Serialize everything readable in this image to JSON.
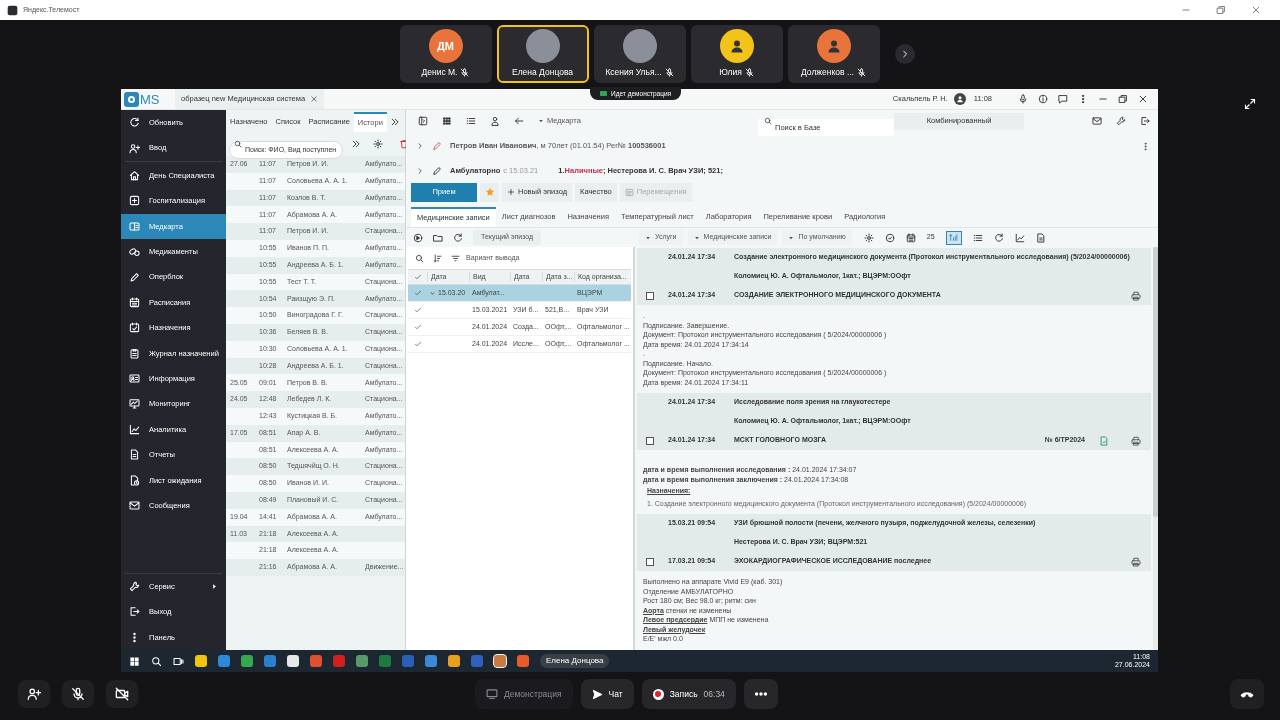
{
  "meeting": {
    "title": "Яндекс.Телемост"
  },
  "participants": [
    {
      "kind": "initials",
      "initials": "ДМ",
      "name": "Денис М.",
      "color": "#e8743b",
      "muted": true,
      "selected": false
    },
    {
      "kind": "photo",
      "name": "Елена Донцова",
      "muted": false,
      "selected": true
    },
    {
      "kind": "photo",
      "name": "Ксения Улья...",
      "muted": true,
      "selected": false
    },
    {
      "kind": "silhouette",
      "name": "Юлия",
      "color": "#f2c318",
      "muted": true,
      "selected": false
    },
    {
      "kind": "silhouette",
      "name": "Долженков ...",
      "color": "#e8743b",
      "muted": true,
      "selected": false
    }
  ],
  "demo_banner": "Идет демонстрация",
  "app": {
    "logo": "MS",
    "doc_tab": "образец new Медицинская система",
    "user": "Скальпель Р. Н.",
    "time": "11:08",
    "sidebar": {
      "items": [
        {
          "label": "Обновить",
          "selected": false
        },
        {
          "label": "Ввод",
          "selected": false
        },
        {
          "label": "День Специалиста",
          "selected": false
        },
        {
          "label": "Госпитализация",
          "selected": false
        },
        {
          "label": "Медкарта",
          "selected": true
        },
        {
          "label": "Медикаменты",
          "selected": false
        },
        {
          "label": "Оперблок",
          "selected": false
        },
        {
          "label": "Расписания",
          "selected": false
        },
        {
          "label": "Назначения",
          "selected": false
        },
        {
          "label": "Журнал назначений",
          "selected": false
        },
        {
          "label": "Информация",
          "selected": false
        },
        {
          "label": "Мониторинг",
          "selected": false
        },
        {
          "label": "Аналитика",
          "selected": false
        },
        {
          "label": "Отчеты",
          "selected": false
        },
        {
          "label": "Лист ожидания",
          "selected": false
        },
        {
          "label": "Сообщения",
          "selected": false
        }
      ],
      "footer_items": [
        {
          "label": "Сервис",
          "has_submenu": true
        },
        {
          "label": "Выход",
          "has_submenu": false
        },
        {
          "label": "Панель",
          "has_submenu": false
        }
      ]
    },
    "list": {
      "tabs": [
        {
          "label": "Назначено",
          "selected": false
        },
        {
          "label": "Список",
          "selected": false
        },
        {
          "label": "Расписание",
          "selected": false
        },
        {
          "label": "Истори",
          "selected": true
        }
      ],
      "search": {
        "placeholder": "Поиск: ФИО, Вид поступлен"
      },
      "rows": [
        {
          "date": "27.06",
          "time": "11:07",
          "name": "Петров И. И.",
          "type": "Амбулато..."
        },
        {
          "time": "11:07",
          "name": "Соловьева А. А. 1.",
          "type": "Амбулато..."
        },
        {
          "time": "11:07",
          "name": "Козлов В. Т.",
          "type": "Амбулато..."
        },
        {
          "time": "11:07",
          "name": "Абрамова А. А.",
          "type": "Амбулато..."
        },
        {
          "time": "11:07",
          "name": "Петров И. И.",
          "type": "Стациона..."
        },
        {
          "time": "10:55",
          "name": "Иванов П. П.",
          "type": "Амбулато..."
        },
        {
          "time": "10:55",
          "name": "Андреева А. Б. 1.",
          "type": "Амбулато..."
        },
        {
          "time": "10:55",
          "name": "Тест Т. Т.",
          "type": "Стациона..."
        },
        {
          "time": "10:54",
          "name": "Раизщую Э. П.",
          "type": "Амбулато..."
        },
        {
          "time": "10:50",
          "name": "Виноградова Г. Г.",
          "type": "Стациона..."
        },
        {
          "time": "10:36",
          "name": "Беляев В. В.",
          "type": "Стациона..."
        },
        {
          "time": "10:30",
          "name": "Соловьева А. А. 1.",
          "type": "Стациона..."
        },
        {
          "time": "10:28",
          "name": "Андреева А. Б. 1.",
          "type": "Стациона..."
        },
        {
          "date": "25.05",
          "time": "09:01",
          "name": "Петров В. В.",
          "type": "Амбулато..."
        },
        {
          "date": "24.05",
          "time": "12:48",
          "name": "Лебедев Л. К.",
          "type": "Стациона..."
        },
        {
          "time": "12:43",
          "name": "Кустицкая В. Б.",
          "type": "Амбулато..."
        },
        {
          "date": "17.05",
          "time": "08:51",
          "name": "Апар А. В.",
          "type": "Амбулато..."
        },
        {
          "time": "08:51",
          "name": "Алексеева А. А.",
          "type": "Амбулато..."
        },
        {
          "time": "08:50",
          "name": "Тедшячйщ О. Н.",
          "type": "Стациона..."
        },
        {
          "time": "08:50",
          "name": "Иванов И. И.",
          "type": "Стациона..."
        },
        {
          "time": "08:49",
          "name": "Плановый И. С.",
          "type": "Стациона..."
        },
        {
          "date": "19.04",
          "time": "14:41",
          "name": "Абрамова А. А.",
          "type": "Амбулато..."
        },
        {
          "date": "11.03",
          "time": "21:18",
          "name": "Алексеева А. А."
        },
        {
          "time": "21:18",
          "name": "Алексеева А. А."
        },
        {
          "time": "21:16",
          "name": "Абрамова А. А.",
          "type": "Движение..."
        }
      ]
    },
    "toolbar": {
      "breadcrumb": "Медкарта",
      "search": {
        "placeholder": "Поиск в Базе"
      },
      "mode": "Комбинированный"
    },
    "patient": {
      "summary": "**Петров Иван Иванович**, м 70лет (01.01.54) Рег№ **100536001**"
    },
    "episode": {
      "type": "Амбулаторно",
      "since": "с 15.03.21",
      "payment_number": "1.",
      "payment": "Наличные",
      "details": "; Нестерова И. С. Врач УЗИ; 521;"
    },
    "actions": [
      {
        "kind": "primary",
        "label": "Прием",
        "disabled": false
      },
      {
        "kind": "favorite",
        "disabled": false
      },
      {
        "kind": "add",
        "label": "Новый эпизод",
        "disabled": false
      },
      {
        "kind": "plain",
        "label": "Качество",
        "disabled": false
      },
      {
        "kind": "move",
        "label": "Перемещения",
        "disabled": true
      }
    ],
    "record_tabs": [
      {
        "label": "Медицинские записи",
        "selected": true
      },
      {
        "label": "Лист диагнозов",
        "selected": false
      },
      {
        "label": "Назначения",
        "selected": false
      },
      {
        "label": "Температурный лист",
        "selected": false
      },
      {
        "label": "Лаборатория",
        "selected": false
      },
      {
        "label": "Переливание крови",
        "selected": false
      },
      {
        "label": "Радиология",
        "selected": false
      }
    ],
    "episode_filter": "Текущий эпизод",
    "filters": [
      "Услуги",
      "Медицинские записи",
      "По умолчанию"
    ],
    "page_size": "25",
    "tree": {
      "output_variant": "Вариант вывода",
      "all_checked": true,
      "columns": [
        "Дата",
        "Вид",
        "Дата",
        "Дата з...",
        "Код организа..."
      ],
      "rows": [
        {
          "checked": true,
          "expanded": true,
          "selected": true,
          "col_1": "15.03.20",
          "col_2": "Амбулат...",
          "col_5": "ВЦЭРМ",
          "children": [
            {
              "checked": true,
              "selected": false,
              "col_2": "15.03.2021",
              "col_3": "УЗИ б...",
              "col_4": "521,В...",
              "col_5": "Врач УЗИ"
            },
            {
              "checked": true,
              "selected": false,
              "col_2": "24.01.2024",
              "col_3": "Созда...",
              "col_4": "ООфт,...",
              "col_5": "Офтальмолог ..."
            },
            {
              "checked": true,
              "selected": false,
              "col_2": "24.01.2024",
              "col_3": "Иссле...",
              "col_4": "ООфт,...",
              "col_5": "Офтальмолог ..."
            }
          ]
        }
      ]
    },
    "records": [
      {
        "kind": "summary",
        "date": "24.01.24 17:34",
        "title": "Создание электронного медицинского документа (Протокол инструментального исследования) (5/2024/00000006)",
        "author": "Коломиец Ю. А. Офтальмолог, 1кат.; ВЦЭРМ:ООфт"
      },
      {
        "kind": "document",
        "checked": false,
        "date": "24.01.24 17:34",
        "title": "СОЗДАНИЕ ЭЛЕКТРОННОГО МЕДИЦИНСКОГО ДОКУМЕНТА",
        "attachment": false
      },
      {
        "kind": "note",
        "lines": [
          {
            "kind": "plain",
            "text": "."
          },
          {
            "kind": "plain",
            "text": "Подписание. Завершение."
          },
          {
            "kind": "plain",
            "text": "Документ: Протокол инструментального исследования ( 5/2024/00000006 )"
          },
          {
            "kind": "plain",
            "text": "Дата время: 24.01.2024 17:34:14"
          },
          {
            "kind": "plain",
            "text": "."
          },
          {
            "kind": "plain",
            "text": "Подписание. Начало."
          },
          {
            "kind": "plain",
            "text": "Документ: Протокол инструментального исследования ( 5/2024/00000006 )"
          },
          {
            "kind": "plain",
            "text": "Дата время: 24.01.2024 17:34:11"
          }
        ]
      },
      {
        "kind": "summary",
        "date": "24.01.24 17:34",
        "title": "Исследование поля зрения на глаукотестере",
        "author": "Коломиец Ю. А. Офтальмолог, 1кат.; ВЦЭРМ:ООфт"
      },
      {
        "kind": "document",
        "checked": false,
        "date": "24.01.24 17:34",
        "title": "МСКТ ГОЛОВНОГО МОЗГА",
        "number": "№ 6/ТР2024",
        "attachment": true
      },
      {
        "kind": "note",
        "lines": [
          {
            "kind": "labeled",
            "label": "дата и время выполнения исследования :",
            "text": "24.01.2024 17:34:07"
          },
          {
            "kind": "labeled",
            "label": "дата и время выполнения заключения :",
            "text": "24.01.2024 17:34:08"
          },
          {
            "kind": "heading",
            "text": "Назначения:"
          },
          {
            "kind": "numbered",
            "number": "1.",
            "text": "Создание электронного медицинского документа (Протокол инструментального исследования) (5/2024/00000006)"
          }
        ]
      },
      {
        "kind": "summary",
        "date": "15.03.21 09:54",
        "title": "УЗИ брюшной полости (печени, желчного пузыря, поджелудочной железы, селезенки)",
        "author": "Нестерова И. С. Врач УЗИ; ВЦЭРМ:521"
      },
      {
        "kind": "document",
        "checked": false,
        "date": "17.03.21 09:54",
        "title": "ЭХОКАРДИОГРАФИЧЕСКОЕ ИССЛЕДОВАНИЕ последнее",
        "attachment": false
      },
      {
        "kind": "note",
        "lines": [
          {
            "kind": "plain",
            "text": "Выполнено на аппарате Vivid E9 (каб. 301)"
          },
          {
            "kind": "plain",
            "text": "Отделение АМБУЛАТОРНО"
          },
          {
            "kind": "plain",
            "text": "Рост 180 см; Вес 98.0 кг; ритм: син"
          },
          {
            "kind": "link",
            "label": "Аорта",
            "text": "стенки не изменены"
          },
          {
            "kind": "link",
            "label": "Левое предсердие",
            "text": "МПП не изменена"
          },
          {
            "kind": "link",
            "label": "Левый желудочек"
          },
          {
            "kind": "plain",
            "text": "E/E' мжл 0.0"
          }
        ]
      }
    ]
  },
  "taskbar": {
    "active_window": "Елена Донцова",
    "time": "11:08",
    "date": "27.06.2024"
  },
  "controls": [
    {
      "kind": "share",
      "label": "Демонстрация",
      "disabled": true
    },
    {
      "kind": "chat",
      "label": "Чат",
      "disabled": false
    },
    {
      "kind": "record",
      "label": "Запись",
      "time": "06:34",
      "disabled": false
    }
  ]
}
